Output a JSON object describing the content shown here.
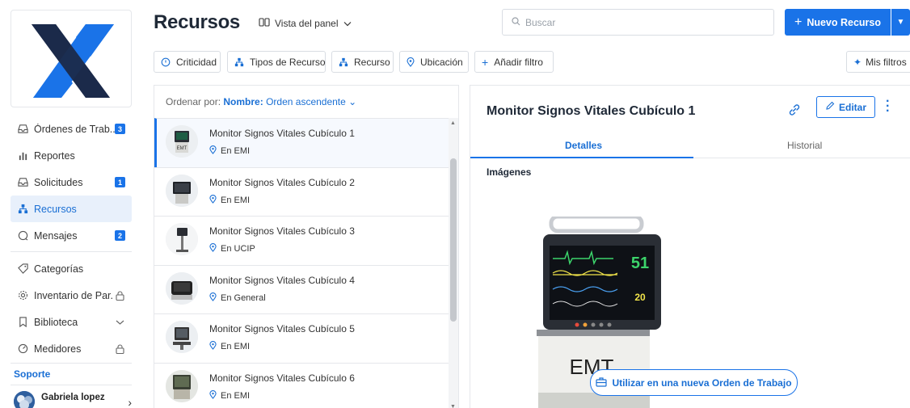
{
  "sidebar": {
    "items": [
      {
        "label": "Órdenes de Trab...",
        "icon": "inbox-icon",
        "badge": "3"
      },
      {
        "label": "Reportes",
        "icon": "bar-chart-icon"
      },
      {
        "label": "Solicitudes",
        "icon": "inbox-icon",
        "badge": "1"
      },
      {
        "label": "Recursos",
        "icon": "hierarchy-icon"
      },
      {
        "label": "Mensajes",
        "icon": "chat-icon",
        "badge": "2"
      },
      {
        "label": "Categorías",
        "icon": "tag-icon"
      },
      {
        "label": "Inventario de Par...",
        "icon": "gear-icon",
        "trail": "lock-icon"
      },
      {
        "label": "Biblioteca",
        "icon": "book-icon",
        "trail": "chevron-down-icon"
      },
      {
        "label": "Medidores",
        "icon": "gauge-icon",
        "trail": "lock-icon"
      }
    ],
    "support_label": "Soporte",
    "user_name": "Gabriela lopez"
  },
  "header": {
    "title": "Recursos",
    "view_toggle": "Vista del panel",
    "search_placeholder": "Buscar",
    "new_button": "Nuevo Recurso"
  },
  "filters": [
    "Criticidad",
    "Tipos de Recurso",
    "Recurso",
    "Ubicación",
    "Añadir filtro"
  ],
  "my_filters": "Mis filtros",
  "list": {
    "sort_prefix": "Ordenar por:",
    "sort_field": "Nombre:",
    "sort_order": "Orden ascendente",
    "rows": [
      {
        "name": "Monitor Signos Vitales Cubículo 1",
        "location": "En EMI"
      },
      {
        "name": "Monitor Signos Vitales Cubículo 2",
        "location": "En EMI"
      },
      {
        "name": "Monitor Signos Vitales Cubículo 3",
        "location": "En UCIP"
      },
      {
        "name": "Monitor Signos Vitales Cubículo 4",
        "location": "En General"
      },
      {
        "name": "Monitor Signos Vitales Cubículo 5",
        "location": "En EMI"
      },
      {
        "name": "Monitor Signos Vitales Cubículo 6",
        "location": "En EMI"
      }
    ]
  },
  "detail": {
    "title": "Monitor Signos Vitales Cubículo 1",
    "edit_label": "Editar",
    "tabs": [
      "Detalles",
      "Historial"
    ],
    "images_label": "Imágenes",
    "photo_text": {
      "brand": "EMT",
      "value_top": "51",
      "value_bottom": "20"
    },
    "use_button": "Utilizar en una nueva Orden de Trabajo"
  },
  "colors": {
    "accent": "#1a73e8",
    "logo": "#1a73e8",
    "logo_dark": "#1b2a4a"
  }
}
